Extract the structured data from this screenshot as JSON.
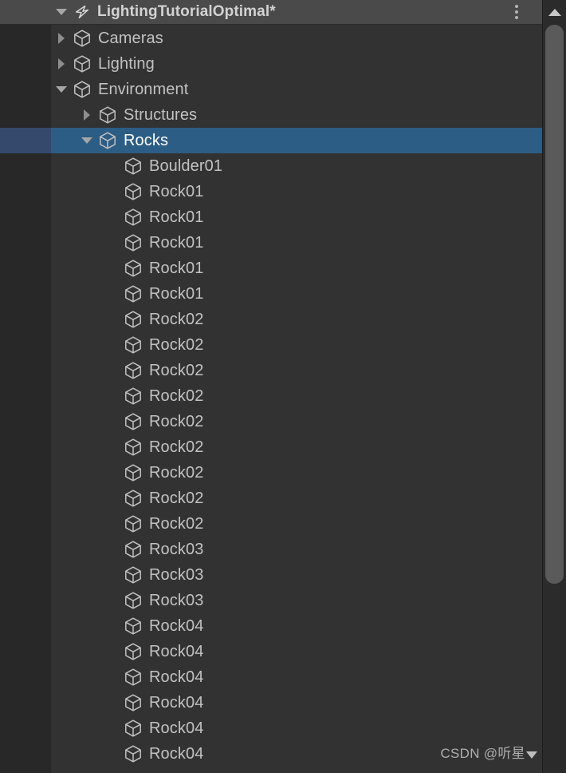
{
  "panel": {
    "title": "LightingTutorialOptimal*",
    "scene_icon": "unity-scene-icon",
    "foldout_icon": "chevron-down-icon",
    "menu_icon": "kebab-menu-icon"
  },
  "colors": {
    "titlebar_bg": "#4a4a4a",
    "panel_bg": "#323232",
    "gutter_bg": "#282828",
    "selection_bg": "#2c5d85",
    "selection_gutter_bg": "#34496b",
    "label": "#c2c2c2",
    "label_selected": "#ffffff",
    "scrollbar_thumb": "#5a5a5a"
  },
  "scrollbar": {
    "up_arrow_icon": "arrow-up-icon",
    "orientation": "vertical"
  },
  "watermark": {
    "text": "CSDN @听星",
    "marker_icon": "triangle-down-icon"
  },
  "tree": {
    "rows": [
      {
        "label": "Cameras",
        "depth": 1,
        "icon": "gameobject-cube-icon",
        "foldout": "collapsed",
        "selected": false
      },
      {
        "label": "Lighting",
        "depth": 1,
        "icon": "gameobject-cube-icon",
        "foldout": "collapsed",
        "selected": false
      },
      {
        "label": "Environment",
        "depth": 1,
        "icon": "gameobject-cube-icon",
        "foldout": "expanded",
        "selected": false
      },
      {
        "label": "Structures",
        "depth": 2,
        "icon": "gameobject-cube-icon",
        "foldout": "collapsed",
        "selected": false
      },
      {
        "label": "Rocks",
        "depth": 2,
        "icon": "gameobject-cube-icon",
        "foldout": "expanded",
        "selected": true
      },
      {
        "label": "Boulder01",
        "depth": 3,
        "icon": "gameobject-cube-icon",
        "foldout": "none",
        "selected": false
      },
      {
        "label": "Rock01",
        "depth": 3,
        "icon": "gameobject-cube-icon",
        "foldout": "none",
        "selected": false
      },
      {
        "label": "Rock01",
        "depth": 3,
        "icon": "gameobject-cube-icon",
        "foldout": "none",
        "selected": false
      },
      {
        "label": "Rock01",
        "depth": 3,
        "icon": "gameobject-cube-icon",
        "foldout": "none",
        "selected": false
      },
      {
        "label": "Rock01",
        "depth": 3,
        "icon": "gameobject-cube-icon",
        "foldout": "none",
        "selected": false
      },
      {
        "label": "Rock01",
        "depth": 3,
        "icon": "gameobject-cube-icon",
        "foldout": "none",
        "selected": false
      },
      {
        "label": "Rock02",
        "depth": 3,
        "icon": "gameobject-cube-icon",
        "foldout": "none",
        "selected": false
      },
      {
        "label": "Rock02",
        "depth": 3,
        "icon": "gameobject-cube-icon",
        "foldout": "none",
        "selected": false
      },
      {
        "label": "Rock02",
        "depth": 3,
        "icon": "gameobject-cube-icon",
        "foldout": "none",
        "selected": false
      },
      {
        "label": "Rock02",
        "depth": 3,
        "icon": "gameobject-cube-icon",
        "foldout": "none",
        "selected": false
      },
      {
        "label": "Rock02",
        "depth": 3,
        "icon": "gameobject-cube-icon",
        "foldout": "none",
        "selected": false
      },
      {
        "label": "Rock02",
        "depth": 3,
        "icon": "gameobject-cube-icon",
        "foldout": "none",
        "selected": false
      },
      {
        "label": "Rock02",
        "depth": 3,
        "icon": "gameobject-cube-icon",
        "foldout": "none",
        "selected": false
      },
      {
        "label": "Rock02",
        "depth": 3,
        "icon": "gameobject-cube-icon",
        "foldout": "none",
        "selected": false
      },
      {
        "label": "Rock02",
        "depth": 3,
        "icon": "gameobject-cube-icon",
        "foldout": "none",
        "selected": false
      },
      {
        "label": "Rock03",
        "depth": 3,
        "icon": "gameobject-cube-icon",
        "foldout": "none",
        "selected": false
      },
      {
        "label": "Rock03",
        "depth": 3,
        "icon": "gameobject-cube-icon",
        "foldout": "none",
        "selected": false
      },
      {
        "label": "Rock03",
        "depth": 3,
        "icon": "gameobject-cube-icon",
        "foldout": "none",
        "selected": false
      },
      {
        "label": "Rock04",
        "depth": 3,
        "icon": "gameobject-cube-icon",
        "foldout": "none",
        "selected": false
      },
      {
        "label": "Rock04",
        "depth": 3,
        "icon": "gameobject-cube-icon",
        "foldout": "none",
        "selected": false
      },
      {
        "label": "Rock04",
        "depth": 3,
        "icon": "gameobject-cube-icon",
        "foldout": "none",
        "selected": false
      },
      {
        "label": "Rock04",
        "depth": 3,
        "icon": "gameobject-cube-icon",
        "foldout": "none",
        "selected": false
      },
      {
        "label": "Rock04",
        "depth": 3,
        "icon": "gameobject-cube-icon",
        "foldout": "none",
        "selected": false
      },
      {
        "label": "Rock04",
        "depth": 3,
        "icon": "gameobject-cube-icon",
        "foldout": "none",
        "selected": false
      }
    ]
  }
}
